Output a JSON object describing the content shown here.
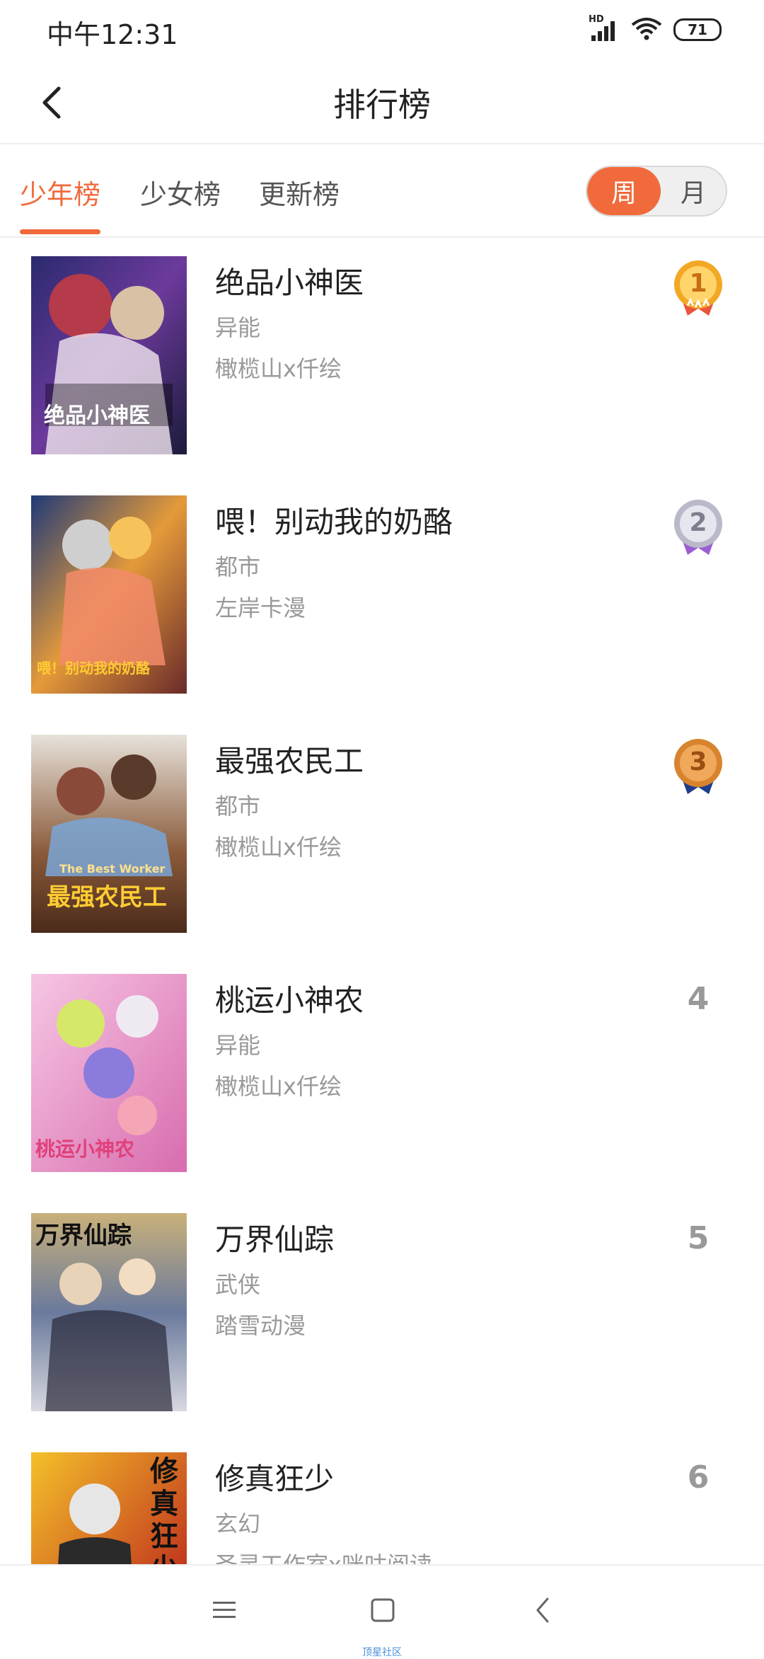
{
  "status": {
    "time": "中午12:31",
    "network": "HD",
    "battery": "71"
  },
  "header": {
    "title": "排行榜",
    "back_icon": "chevron-left-icon"
  },
  "tabs": [
    {
      "label": "少年榜",
      "active": true
    },
    {
      "label": "少女榜",
      "active": false
    },
    {
      "label": "更新榜",
      "active": false
    }
  ],
  "period": {
    "week": "周",
    "month": "月",
    "selected": "周"
  },
  "colors": {
    "accent": "#f06a3c",
    "gold": "#f2a825",
    "silver": "#b9b9c9",
    "bronze": "#d8842f"
  },
  "ranking": [
    {
      "rank": "1",
      "title": "绝品小神医",
      "genre": "异能",
      "author": "橄榄山x仟绘",
      "cover_text": "绝品小神医",
      "badge": "gold-medal"
    },
    {
      "rank": "2",
      "title": "喂！别动我的奶酪",
      "genre": "都市",
      "author": "左岸卡漫",
      "cover_text": "喂！别动我的奶酪",
      "badge": "silver-medal"
    },
    {
      "rank": "3",
      "title": "最强农民工",
      "genre": "都市",
      "author": "橄榄山x仟绘",
      "cover_text": "最强农民工",
      "cover_subtext": "The Best Worker",
      "badge": "bronze-medal"
    },
    {
      "rank": "4",
      "title": "桃运小神农",
      "genre": "异能",
      "author": "橄榄山x仟绘",
      "cover_text": "桃运小神农"
    },
    {
      "rank": "5",
      "title": "万界仙踪",
      "genre": "武侠",
      "author": "踏雪动漫",
      "cover_text": "万界仙踪"
    },
    {
      "rank": "6",
      "title": "修真狂少",
      "genre": "玄幻",
      "author": "圣灵工作室x咪咕阅读",
      "cover_text": "修真狂少"
    }
  ],
  "nav": {
    "watermark": "顶星社区"
  }
}
